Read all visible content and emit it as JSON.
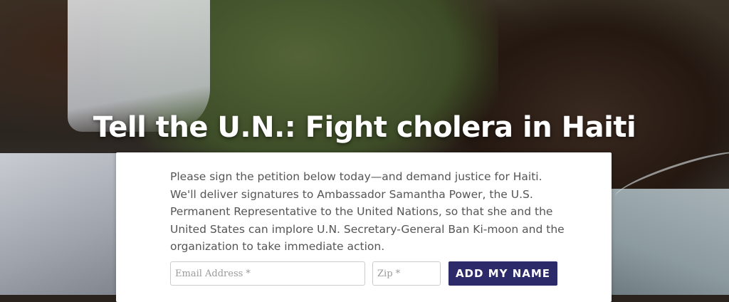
{
  "hero": {
    "headline": "Tell the U.N.: Fight cholera in Haiti"
  },
  "petition": {
    "intro": "Please sign the petition below today—and demand justice for Haiti. We'll deliver signatures to Ambassador Samantha Power, the U.S. Permanent Representative to the United Nations, so that she and the United States can implore U.N. Secretary-General Ban Ki-moon and the organization to take immediate action.",
    "email": {
      "value": "",
      "placeholder": "Email Address *"
    },
    "zip": {
      "value": "",
      "placeholder": "Zip *"
    },
    "submit_label": "ADD MY NAME"
  },
  "colors": {
    "button": "#2d2a6a",
    "headline": "#ffffff",
    "body_text": "#555555"
  }
}
